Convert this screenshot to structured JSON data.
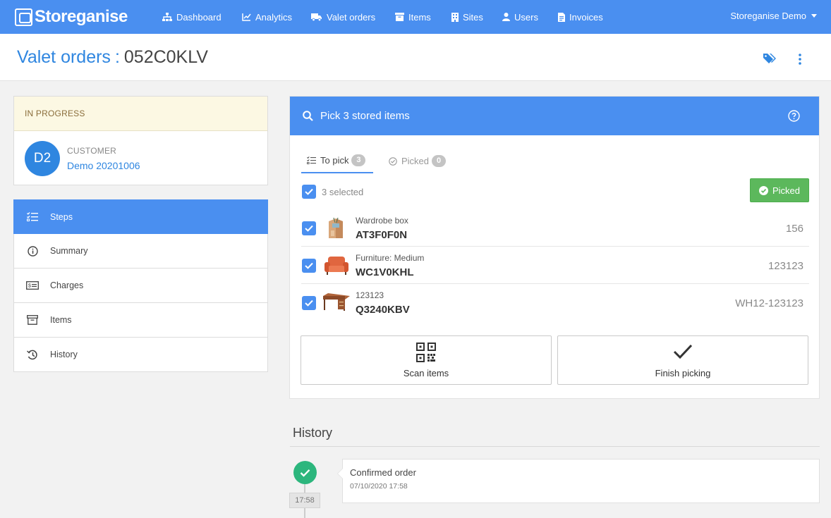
{
  "brand": {
    "name": "Storeganise"
  },
  "nav": {
    "items": [
      {
        "label": "Dashboard",
        "icon": "sitemap-icon"
      },
      {
        "label": "Analytics",
        "icon": "line-chart-icon"
      },
      {
        "label": "Valet orders",
        "icon": "truck-icon"
      },
      {
        "label": "Items",
        "icon": "archive-box-icon"
      },
      {
        "label": "Sites",
        "icon": "building-icon"
      },
      {
        "label": "Users",
        "icon": "user-icon"
      },
      {
        "label": "Invoices",
        "icon": "invoice-icon"
      }
    ],
    "user_menu": "Storeganise Demo"
  },
  "header": {
    "breadcrumb": "Valet orders",
    "separator": ":",
    "order_code": "052C0KLV"
  },
  "order": {
    "status": "IN PROGRESS",
    "customer_label": "CUSTOMER",
    "customer_initials": "D2",
    "customer_name": "Demo 20201006"
  },
  "sidebar": {
    "items": [
      {
        "label": "Steps",
        "icon": "list-check-icon",
        "active": true
      },
      {
        "label": "Summary",
        "icon": "info-circle-icon",
        "active": false
      },
      {
        "label": "Charges",
        "icon": "money-bill-icon",
        "active": false
      },
      {
        "label": "Items",
        "icon": "archive-box-icon",
        "active": false
      },
      {
        "label": "History",
        "icon": "history-icon",
        "active": false
      }
    ]
  },
  "pick": {
    "title": "Pick 3 stored items",
    "tabs": [
      {
        "label": "To pick",
        "count": "3",
        "active": true
      },
      {
        "label": "Picked",
        "count": "0",
        "active": false
      }
    ],
    "selected_text": "3 selected",
    "picked_button": "Picked",
    "items": [
      {
        "type": "Wardrobe box",
        "code": "AT3F0F0N",
        "ref": "156",
        "checked": true,
        "image": "wardrobe-box-image"
      },
      {
        "type": "Furniture: Medium",
        "code": "WC1V0KHL",
        "ref": "123123",
        "checked": true,
        "image": "armchair-image"
      },
      {
        "type": "123123",
        "code": "Q3240KBV",
        "ref": "WH12-123123",
        "checked": true,
        "image": "desk-image"
      }
    ],
    "scan_button": "Scan items",
    "finish_button": "Finish picking"
  },
  "history": {
    "title": "History",
    "events": [
      {
        "time": "17:58",
        "title": "Confirmed order",
        "date": "07/10/2020 17:58"
      }
    ]
  },
  "colors": {
    "primary": "#4a8ff0",
    "link": "#2f86e0",
    "success": "#5cb85c",
    "timeline_success": "#2cb67d",
    "warning_bg": "#fcf8e3"
  }
}
